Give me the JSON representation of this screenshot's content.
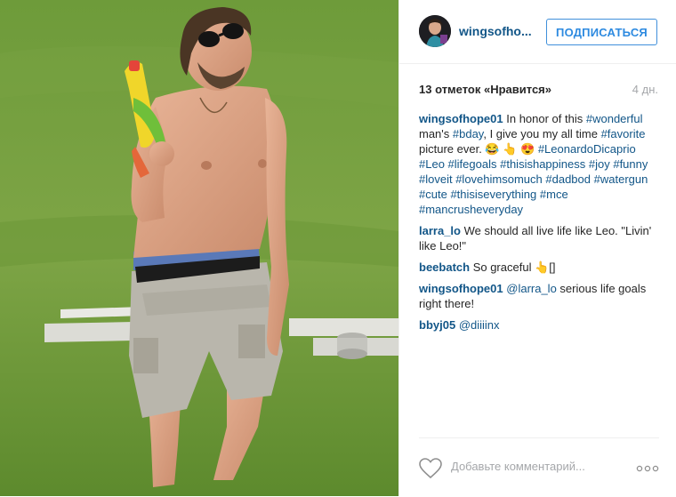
{
  "post": {
    "username": "wingsofho...",
    "follow_label": "ПОДПИСАТЬСЯ",
    "likes_text": "13 отметок «Нравится»",
    "age": "4 дн."
  },
  "comments": [
    {
      "author": "wingsofhope01",
      "parts": [
        " In honor of this ",
        "#wonderful",
        " man's ",
        "#bday",
        ", I give you my all time ",
        "#favorite",
        " picture ever. 😂 👆 😍 ",
        "#LeonardoDicaprio",
        " ",
        "#Leo",
        " ",
        "#lifegoals",
        " ",
        "#thisishappiness",
        " ",
        "#joy",
        " ",
        "#funny",
        " ",
        "#loveit",
        " ",
        "#lovehimsomuch",
        " ",
        "#dadbod",
        " ",
        "#watergun",
        " ",
        "#cute",
        " ",
        "#thisiseverything",
        " ",
        "#mce",
        " ",
        "#mancrusheveryday"
      ]
    },
    {
      "author": "larra_lo",
      "text": " We should all live life like Leo. \"Livin' like Leo!\""
    },
    {
      "author": "beebatch",
      "text": " So graceful 👆[]"
    },
    {
      "author": "wingsofhope01",
      "mention": "@larra_lo",
      "text": " serious life goals right there!"
    },
    {
      "author": "bbyj05",
      "mention": "@diiiinx",
      "text": ""
    }
  ],
  "footer": {
    "comment_placeholder": "Добавьте комментарий...",
    "like_icon": "heart-icon",
    "more_icon": "more-options-icon"
  },
  "colors": {
    "link": "#125688",
    "follow_border": "#4090db",
    "muted": "#a5a7aa",
    "photo_grass": "#6f9a3c"
  }
}
